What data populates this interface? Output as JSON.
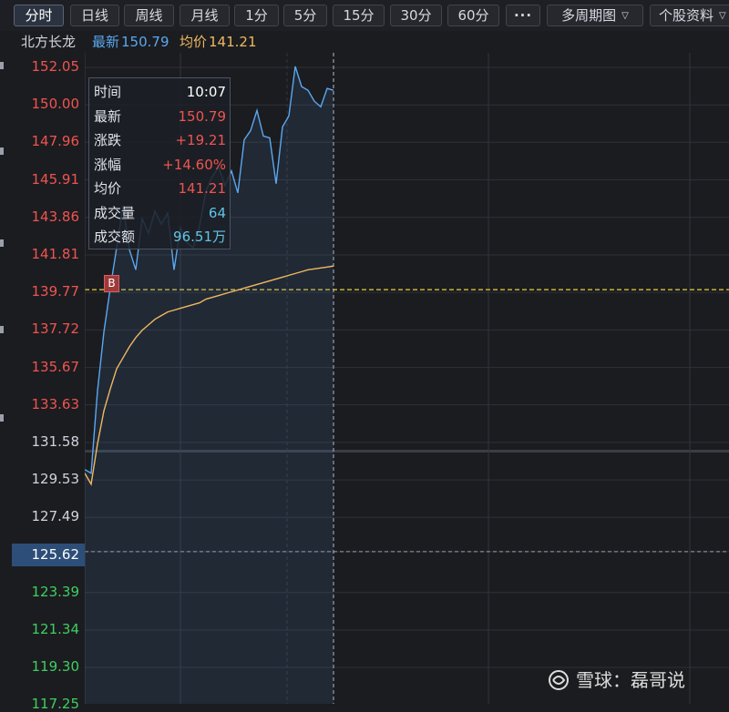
{
  "toolbar": {
    "buttons": [
      "分时",
      "日线",
      "周线",
      "月线",
      "1分",
      "5分",
      "15分",
      "30分",
      "60分"
    ],
    "active": "分时",
    "more_label": "···",
    "period_dropdown": "多周期图",
    "info_dropdown": "个股资料"
  },
  "info_bar": {
    "stock_name": "北方长龙",
    "latest_label": "最新",
    "latest_value": "150.79",
    "avg_label": "均价",
    "avg_value": "141.21"
  },
  "y_axis": {
    "ticks": [
      "152.05",
      "150.00",
      "147.96",
      "145.91",
      "143.86",
      "141.81",
      "139.77",
      "137.72",
      "135.67",
      "133.63",
      "131.58",
      "129.53",
      "127.49",
      "125.62",
      "123.39",
      "121.34",
      "119.30",
      "117.25"
    ],
    "prev_close": "125.62"
  },
  "tooltip": {
    "rows": [
      {
        "label": "时间",
        "value": "10:07",
        "color": "#ffffff"
      },
      {
        "label": "最新",
        "value": "150.79",
        "color": "#f0544f"
      },
      {
        "label": "涨跌",
        "value": "+19.21",
        "color": "#f0544f"
      },
      {
        "label": "涨幅",
        "value": "+14.60%",
        "color": "#f0544f"
      },
      {
        "label": "均价",
        "value": "141.21",
        "color": "#f0544f"
      },
      {
        "label": "成交量",
        "value": "64",
        "color": "#5fc6e8"
      },
      {
        "label": "成交额",
        "value": "96.51万",
        "color": "#5fc6e8"
      }
    ]
  },
  "buy_marker": "B",
  "watermark": "雪球：磊哥说",
  "colors": {
    "price_line": "#5aa8f0",
    "avg_line": "#f0b860",
    "up": "#f0544f",
    "down": "#3fcf5f",
    "neutral": "#cfd3dc",
    "buy_line": "#e8d040"
  },
  "chart_data": {
    "type": "line",
    "title": "",
    "xlabel": "",
    "ylabel": "",
    "ylim": [
      117.25,
      153.5
    ],
    "reference": {
      "prev_close": 125.62,
      "buy_price": 139.77
    },
    "series": [
      {
        "name": "最新",
        "x": [
          0,
          1,
          2,
          3,
          4,
          5,
          6,
          7,
          8,
          9,
          10,
          11,
          12,
          13,
          14,
          15,
          16,
          17,
          18,
          19,
          20,
          21,
          22,
          23,
          24,
          25,
          26,
          27,
          28,
          29,
          30,
          31,
          32,
          33,
          34,
          35,
          36,
          37,
          38,
          39
        ],
        "values": [
          130.1,
          129.9,
          134.4,
          137.6,
          140.0,
          142.2,
          144.5,
          142.1,
          141.0,
          143.8,
          143.0,
          144.2,
          143.5,
          144.1,
          141.0,
          143.3,
          142.5,
          142.2,
          143.4,
          145.3,
          146.1,
          146.6,
          145.6,
          146.4,
          145.2,
          148.1,
          148.6,
          149.7,
          148.3,
          148.2,
          145.7,
          148.8,
          149.4,
          152.1,
          151.0,
          150.8,
          150.2,
          149.9,
          150.9,
          150.8
        ]
      },
      {
        "name": "均价",
        "x": [
          0,
          1,
          2,
          3,
          4,
          5,
          6,
          7,
          8,
          9,
          10,
          11,
          12,
          13,
          14,
          15,
          16,
          17,
          18,
          19,
          20,
          21,
          22,
          23,
          24,
          25,
          26,
          27,
          28,
          29,
          30,
          31,
          32,
          33,
          34,
          35,
          36,
          37,
          38,
          39
        ],
        "values": [
          129.9,
          129.3,
          131.5,
          133.3,
          134.5,
          135.6,
          136.2,
          136.8,
          137.3,
          137.7,
          138.0,
          138.3,
          138.5,
          138.7,
          138.8,
          138.9,
          139.0,
          139.1,
          139.2,
          139.4,
          139.5,
          139.6,
          139.7,
          139.8,
          139.9,
          140.0,
          140.1,
          140.2,
          140.3,
          140.4,
          140.5,
          140.6,
          140.7,
          140.8,
          140.9,
          141.0,
          141.05,
          141.1,
          141.15,
          141.21
        ]
      }
    ]
  }
}
